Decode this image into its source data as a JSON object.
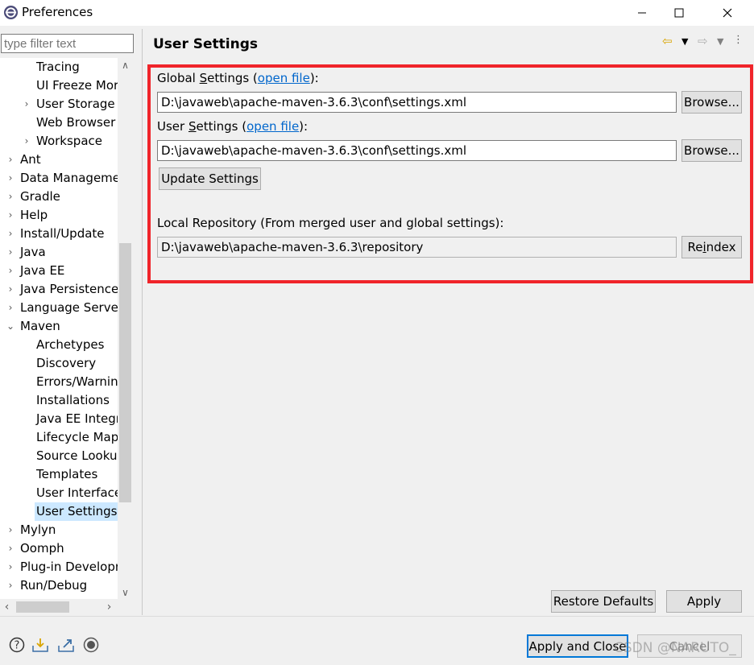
{
  "window": {
    "title": "Preferences",
    "icon": "eclipse-icon",
    "controls": [
      "—",
      "☐",
      "✕"
    ]
  },
  "filter": {
    "placeholder": "type filter text"
  },
  "tree": {
    "items": [
      {
        "label": "Tracing",
        "level": 2,
        "arrow": ""
      },
      {
        "label": "UI Freeze Mor",
        "level": 2,
        "arrow": ""
      },
      {
        "label": "User Storage",
        "level": 2,
        "arrow": "›"
      },
      {
        "label": "Web Browser",
        "level": 2,
        "arrow": ""
      },
      {
        "label": "Workspace",
        "level": 2,
        "arrow": "›"
      },
      {
        "label": "Ant",
        "level": 1,
        "arrow": "›"
      },
      {
        "label": "Data Manageme",
        "level": 1,
        "arrow": "›"
      },
      {
        "label": "Gradle",
        "level": 1,
        "arrow": "›"
      },
      {
        "label": "Help",
        "level": 1,
        "arrow": "›"
      },
      {
        "label": "Install/Update",
        "level": 1,
        "arrow": "›"
      },
      {
        "label": "Java",
        "level": 1,
        "arrow": "›"
      },
      {
        "label": "Java EE",
        "level": 1,
        "arrow": "›"
      },
      {
        "label": "Java Persistence",
        "level": 1,
        "arrow": "›"
      },
      {
        "label": "Language Server",
        "level": 1,
        "arrow": "›"
      },
      {
        "label": "Maven",
        "level": 1,
        "arrow": "⌄"
      },
      {
        "label": "Archetypes",
        "level": 2,
        "arrow": ""
      },
      {
        "label": "Discovery",
        "level": 2,
        "arrow": ""
      },
      {
        "label": "Errors/Warnin",
        "level": 2,
        "arrow": ""
      },
      {
        "label": "Installations",
        "level": 2,
        "arrow": ""
      },
      {
        "label": "Java EE Integra",
        "level": 2,
        "arrow": ""
      },
      {
        "label": "Lifecycle Map",
        "level": 2,
        "arrow": ""
      },
      {
        "label": "Source Looku",
        "level": 2,
        "arrow": ""
      },
      {
        "label": "Templates",
        "level": 2,
        "arrow": ""
      },
      {
        "label": "User Interface",
        "level": 2,
        "arrow": ""
      },
      {
        "label": "User Settings",
        "level": 2,
        "arrow": "",
        "selected": true
      },
      {
        "label": "Mylyn",
        "level": 1,
        "arrow": "›"
      },
      {
        "label": "Oomph",
        "level": 1,
        "arrow": "›"
      },
      {
        "label": "Plug-in Developr",
        "level": 1,
        "arrow": "›"
      },
      {
        "label": "Run/Debug",
        "level": 1,
        "arrow": "›"
      }
    ]
  },
  "page": {
    "title": "User Settings",
    "global_label_pre": "Global ",
    "global_label_s": "S",
    "global_label_mid": "ettings (",
    "global_link": "open file",
    "global_label_post": "):",
    "global_path": "D:\\javaweb\\apache-maven-3.6.3\\conf\\settings.xml",
    "user_label_pre": "User ",
    "user_label_s": "S",
    "user_label_mid": "ettings (",
    "user_link": "open file",
    "user_label_post": "):",
    "user_path": "D:\\javaweb\\apache-maven-3.6.3\\conf\\settings.xml",
    "browse1": "Browse...",
    "browse2": "Browse...",
    "update": "Update Settings",
    "local_repo_label": "Local Repository (From merged user and global settings):",
    "local_repo_path": "D:\\javaweb\\apache-maven-3.6.3\\repository",
    "reindex_pre": "Re",
    "reindex_i": "i",
    "reindex_post": "ndex"
  },
  "buttons": {
    "restore_defaults": "Restore Defaults",
    "apply": "Apply",
    "apply_close": "Apply and Close",
    "cancel": "Cancel"
  },
  "watermark": "CSDN @NARUTO_",
  "colors": {
    "highlight_box": "#f0242a",
    "link": "#0066cc",
    "selection": "#cce8ff",
    "default_button_border": "#0078d7"
  }
}
